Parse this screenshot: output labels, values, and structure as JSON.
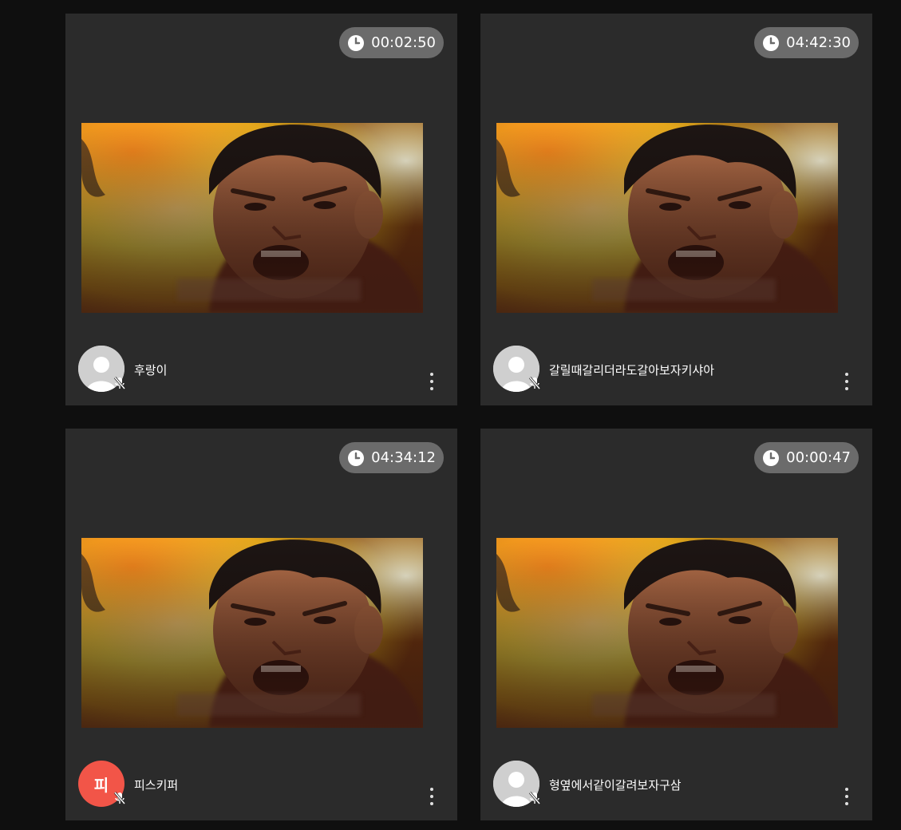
{
  "tiles": [
    {
      "timer": "00:02:50",
      "name": "후랑이",
      "avatar": "default-user-icon",
      "muted": true
    },
    {
      "timer": "04:42:30",
      "name": "갈릴때갈리더라도갈아보자키샤아",
      "avatar": "default-user-icon",
      "muted": true
    },
    {
      "timer": "04:34:12",
      "name": "피스키퍼",
      "avatar_initial": "피",
      "avatar_color": "#f25548",
      "muted": true
    },
    {
      "timer": "00:00:47",
      "name": "형옆에서같이갈려보자구삼",
      "avatar": "default-user-icon",
      "muted": true
    }
  ],
  "colors": {
    "background": "#0f0f0f",
    "card": "#2b2b2b",
    "timer_pill": "#6b6b6b",
    "initial_avatar": "#f25548"
  }
}
